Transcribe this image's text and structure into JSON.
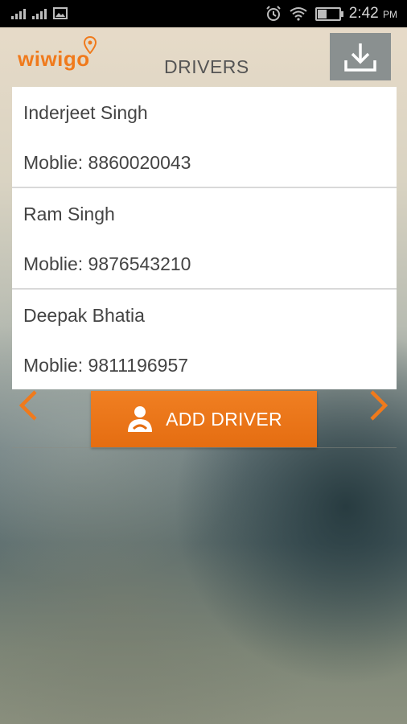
{
  "status_bar": {
    "time": "2:42",
    "ampm": "PM"
  },
  "header": {
    "logo": "wiwigo",
    "title": "DRIVERS",
    "download_icon": "download-icon"
  },
  "drivers": [
    {
      "name": "Inderjeet Singh",
      "mobile": "Moblie: 8860020043"
    },
    {
      "name": "Ram Singh",
      "mobile": "Moblie: 9876543210"
    },
    {
      "name": "Deepak Bhatia",
      "mobile": "Moblie: 9811196957"
    }
  ],
  "actions": {
    "add_driver": "ADD DRIVER"
  },
  "colors": {
    "accent": "#f07a1c",
    "download_bg": "#8a9090"
  }
}
